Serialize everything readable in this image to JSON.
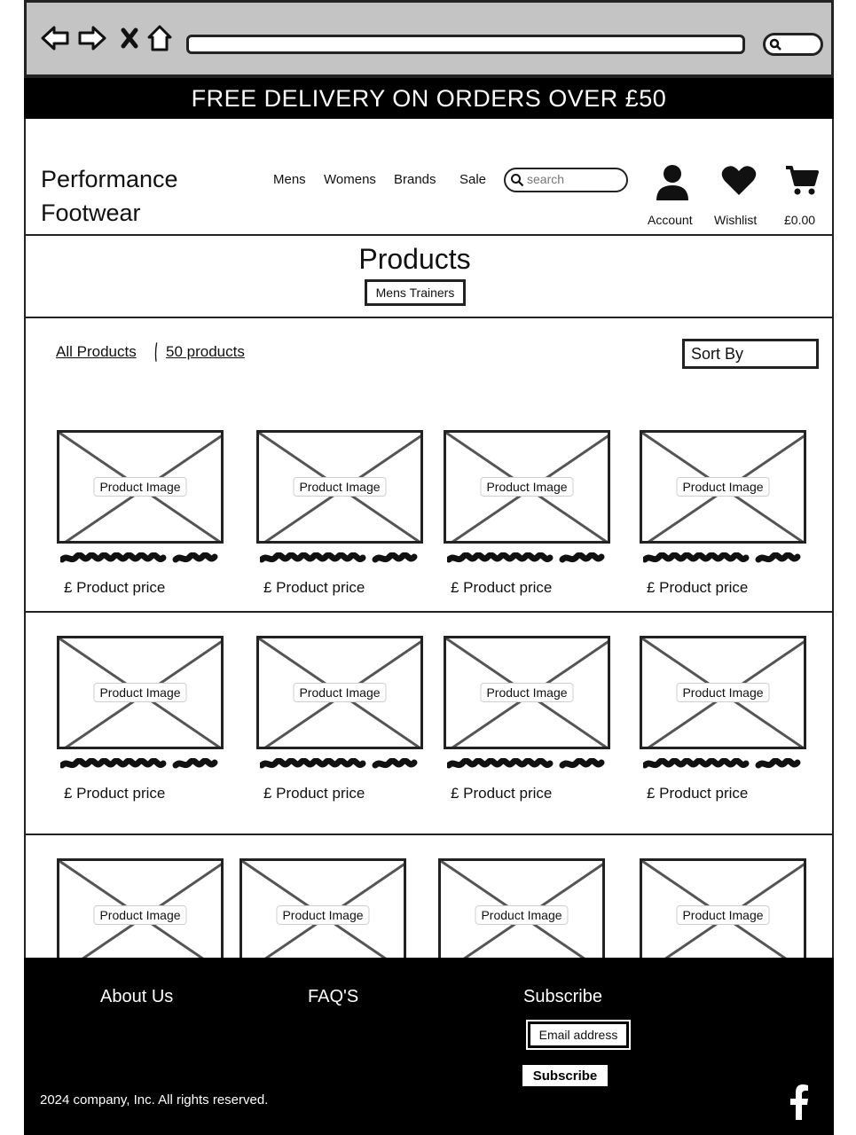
{
  "banner": {
    "text": "FREE DELIVERY ON ORDERS OVER £50"
  },
  "header": {
    "logo_line1": "Performance",
    "logo_line2": "Footwear",
    "nav": [
      "Mens",
      "Womens",
      "Brands",
      "Sale"
    ],
    "search_placeholder": "search",
    "account_label": "Account",
    "wishlist_label": "Wishlist",
    "cart_total": "£0.00"
  },
  "page": {
    "title": "Products",
    "category": "Mens Trainers",
    "breadcrumb_all": "All Products",
    "product_count": "50 products",
    "sort_label": "Sort By"
  },
  "products": {
    "image_label": "Product Image",
    "price_label": "£ Product price"
  },
  "footer": {
    "about": "About Us",
    "faqs": "FAQ'S",
    "subscribe_heading": "Subscribe",
    "email_placeholder": "Email address",
    "subscribe_button": "Subscribe",
    "copyright": "2024 company, Inc. All rights reserved."
  },
  "icons": {
    "back": "back-arrow-icon",
    "forward": "forward-arrow-icon",
    "stop": "close-icon",
    "home": "home-icon",
    "account": "user-icon",
    "wishlist": "heart-icon",
    "cart": "cart-icon",
    "facebook": "facebook-icon"
  }
}
